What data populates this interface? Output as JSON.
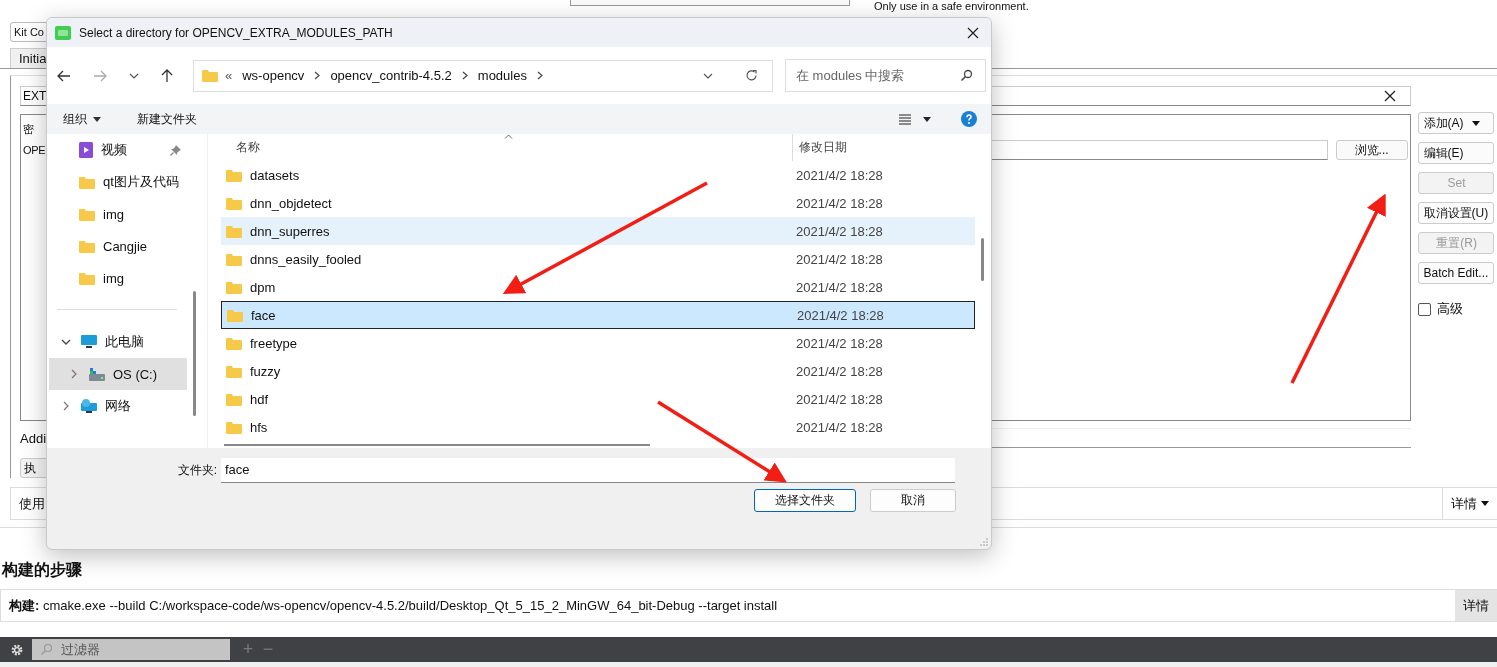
{
  "background": {
    "top_note": "Only use in a safe environment.",
    "kit_combo": "Kit Co",
    "tab": "Initia",
    "key_field": "EXT",
    "table_rows": [
      "密",
      "OPE"
    ],
    "browse_button": "浏览...",
    "side_buttons": [
      {
        "label": "添加(A)",
        "disabled": false,
        "has_menu": true
      },
      {
        "label": "编辑(E)",
        "disabled": false,
        "has_menu": false
      },
      {
        "label": "Set",
        "disabled": true,
        "has_menu": false
      },
      {
        "label": "取消设置(U)",
        "disabled": false,
        "has_menu": false
      },
      {
        "label": "重置(R)",
        "disabled": true,
        "has_menu": false
      },
      {
        "label": "Batch Edit...",
        "disabled": false,
        "has_menu": false
      }
    ],
    "advanced": {
      "label": "高级",
      "checked": false
    },
    "additional_label": "Addi",
    "run_button": "执",
    "use_label": "使用",
    "details_dropdown": "详情",
    "build_steps": {
      "heading": "构建的步骤",
      "command": "**构建:** cmake.exe --build C:/workspace-code/ws-opencv/opencv-4.5.2/build/Desktop_Qt_5_15_2_MinGW_64_bit-Debug --target install",
      "details": "详情"
    },
    "filter_bar": {
      "placeholder": "过滤器",
      "add": "+",
      "remove": "−"
    }
  },
  "dialog": {
    "title": "Select a directory for OPENCV_EXTRA_MODULES_PATH",
    "overflow_mark": "«",
    "breadcrumb": [
      "ws-opencv",
      "opencv_contrib-4.5.2",
      "modules"
    ],
    "search_placeholder": "在 modules 中搜索",
    "toolbar": {
      "organize": "组织",
      "new_folder": "新建文件夹"
    },
    "quick_access": [
      {
        "label": "视频",
        "kind": "video",
        "pinned": true
      },
      {
        "label": "qt图片及代码",
        "kind": "folder",
        "pinned": false
      },
      {
        "label": "img",
        "kind": "folder",
        "pinned": false
      },
      {
        "label": "Cangjie",
        "kind": "folder",
        "pinned": false
      },
      {
        "label": "img",
        "kind": "folder",
        "pinned": false
      }
    ],
    "tree": [
      {
        "label": "此电脑",
        "kind": "pc",
        "expanded": true,
        "selected": false,
        "children": [
          {
            "label": "OS (C:)",
            "kind": "drive",
            "expanded": false,
            "selected": true
          }
        ]
      },
      {
        "label": "网络",
        "kind": "network",
        "expanded": false,
        "selected": false
      }
    ],
    "columns": [
      "名称",
      "修改日期"
    ],
    "files": [
      {
        "name": "datasets",
        "modified": "2021/4/2 18:28",
        "selected": false,
        "hovered": false
      },
      {
        "name": "dnn_objdetect",
        "modified": "2021/4/2 18:28",
        "selected": false,
        "hovered": false
      },
      {
        "name": "dnn_superres",
        "modified": "2021/4/2 18:28",
        "selected": false,
        "hovered": true
      },
      {
        "name": "dnns_easily_fooled",
        "modified": "2021/4/2 18:28",
        "selected": false,
        "hovered": false
      },
      {
        "name": "dpm",
        "modified": "2021/4/2 18:28",
        "selected": false,
        "hovered": false
      },
      {
        "name": "face",
        "modified": "2021/4/2 18:28",
        "selected": true,
        "hovered": false
      },
      {
        "name": "freetype",
        "modified": "2021/4/2 18:28",
        "selected": false,
        "hovered": false
      },
      {
        "name": "fuzzy",
        "modified": "2021/4/2 18:28",
        "selected": false,
        "hovered": false
      },
      {
        "name": "hdf",
        "modified": "2021/4/2 18:28",
        "selected": false,
        "hovered": false
      },
      {
        "name": "hfs",
        "modified": "2021/4/2 18:28",
        "selected": false,
        "hovered": false
      }
    ],
    "folder_label": "文件夹:",
    "folder_value": "face",
    "buttons": [
      {
        "label": "选择文件夹",
        "default": true
      },
      {
        "label": "取消",
        "default": false
      }
    ]
  }
}
